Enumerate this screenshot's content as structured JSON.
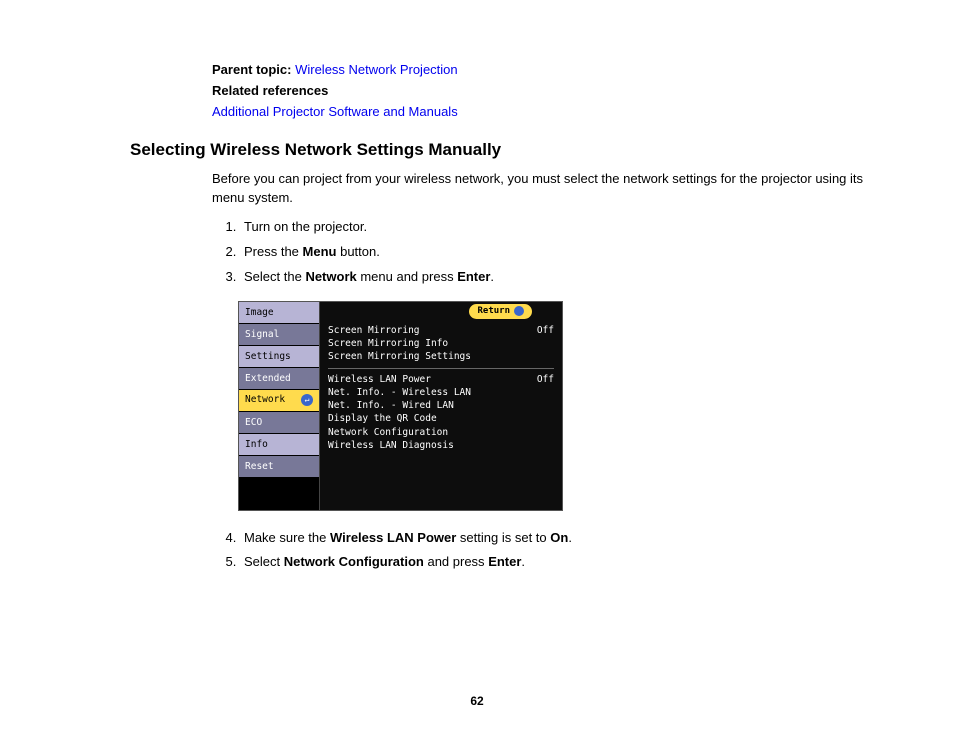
{
  "meta": {
    "parent_label": "Parent topic:",
    "parent_link": "Wireless Network Projection",
    "related_label": "Related references",
    "related_link": "Additional Projector Software and Manuals"
  },
  "heading": "Selecting Wireless Network Settings Manually",
  "intro": "Before you can project from your wireless network, you must select the network settings for the projector using its menu system.",
  "steps": {
    "s1": "Turn on the projector.",
    "s2_pre": "Press the ",
    "s2_b": "Menu",
    "s2_post": " button.",
    "s3_pre": "Select the ",
    "s3_b1": "Network",
    "s3_mid": " menu and press ",
    "s3_b2": "Enter",
    "s3_post": ".",
    "s4_pre": "Make sure the ",
    "s4_b1": "Wireless LAN Power",
    "s4_mid": " setting is set to ",
    "s4_b2": "On",
    "s4_post": ".",
    "s5_pre": "Select ",
    "s5_b1": "Network Configuration",
    "s5_mid": " and press ",
    "s5_b2": "Enter",
    "s5_post": "."
  },
  "menu": {
    "return": "Return",
    "tabs": {
      "t0": "Image",
      "t1": "Signal",
      "t2": "Settings",
      "t3": "Extended",
      "t4": "Network",
      "t5": "ECO",
      "t6": "Info",
      "t7": "Reset"
    },
    "panel": {
      "r0": "Screen Mirroring",
      "r0v": "Off",
      "r1": "Screen Mirroring Info",
      "r2": "Screen Mirroring Settings",
      "r3": "Wireless LAN Power",
      "r3v": "Off",
      "r4": "Net. Info. - Wireless LAN",
      "r5": "Net. Info. - Wired LAN",
      "r6": "Display the QR Code",
      "r7": "Network Configuration",
      "r8": "Wireless LAN Diagnosis"
    }
  },
  "page_number": "62"
}
